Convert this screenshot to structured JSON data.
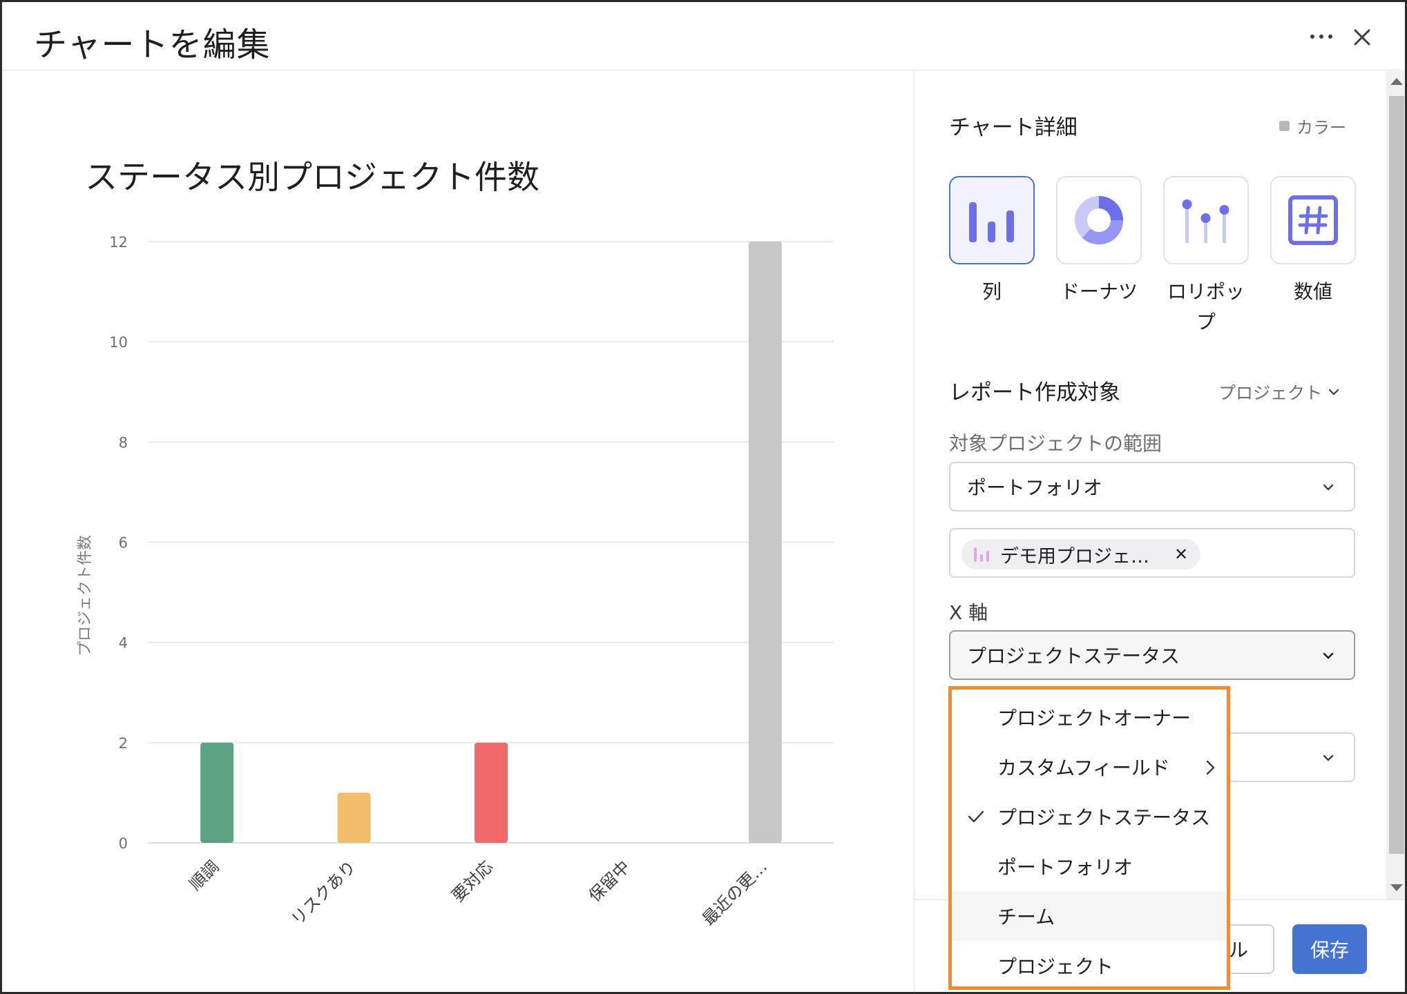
{
  "header": {
    "title": "チャートを編集"
  },
  "chart_data": {
    "type": "bar",
    "title": "ステータス別プロジェクト件数",
    "xlabel": "",
    "ylabel": "プロジェクト件数",
    "categories": [
      "順調",
      "リスクあり",
      "要対応",
      "保留中",
      "最近の更…"
    ],
    "values": [
      2,
      1,
      2,
      0,
      12
    ],
    "colors": [
      "#5da283",
      "#f1bd6c",
      "#f06a6a",
      "#c7c7c7",
      "#c7c7c7"
    ],
    "ylim": [
      0,
      12
    ],
    "yticks": [
      0,
      2,
      4,
      6,
      8,
      10,
      12
    ],
    "grid": true
  },
  "panel": {
    "chart_details_title": "チャート詳細",
    "color_label": "カラー",
    "chart_types": [
      {
        "label": "列",
        "icon": "column-chart-icon",
        "selected": true
      },
      {
        "label": "ドーナツ",
        "icon": "donut-chart-icon",
        "selected": false
      },
      {
        "label": "ロリポップ",
        "icon": "lollipop-chart-icon",
        "selected": false
      },
      {
        "label": "数値",
        "icon": "number-chart-icon",
        "selected": false
      }
    ],
    "report_target_title": "レポート作成対象",
    "report_target_value": "プロジェクト",
    "scope_label": "対象プロジェクトの範囲",
    "scope_value": "ポートフォリオ",
    "portfolio_chip": "デモ用プロジェ…",
    "x_axis_label": "X 軸",
    "x_axis_value": "プロジェクトステータス",
    "y_axis_value": ""
  },
  "menu": {
    "items": [
      {
        "label": "プロジェクトオーナー"
      },
      {
        "label": "カスタムフィールド"
      },
      {
        "label": "プロジェクトステータス"
      },
      {
        "label": "ポートフォリオ"
      },
      {
        "label": "チーム"
      },
      {
        "label": "プロジェクト"
      }
    ],
    "selected_item": "プロジェクトステータス",
    "hovered_item": "チーム",
    "highlight_color": "#f28a2f"
  },
  "footer": {
    "cancel_label": "ル",
    "save_label": "保存"
  },
  "colors": {
    "accent": "#4573d2",
    "chart_type_icon": "#6d6ee9"
  }
}
